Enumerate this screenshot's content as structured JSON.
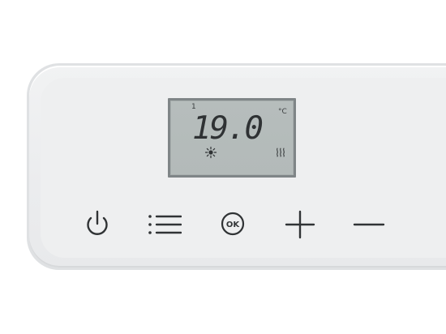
{
  "display": {
    "program_number": "1",
    "temperature": "19.0",
    "unit": "°C"
  },
  "buttons": {
    "ok_label": "OK"
  },
  "icons": {
    "power": "power-icon",
    "menu": "menu-list-icon",
    "ok": "ok-circle-icon",
    "plus": "plus-icon",
    "minus": "minus-icon",
    "comfort_mode": "sun-icon",
    "heating": "heat-waves-icon"
  },
  "colors": {
    "lcd_background": "#b5bcbb",
    "lcd_text": "#2f3234",
    "panel": "#eeeff0",
    "button_symbol": "#303335"
  }
}
